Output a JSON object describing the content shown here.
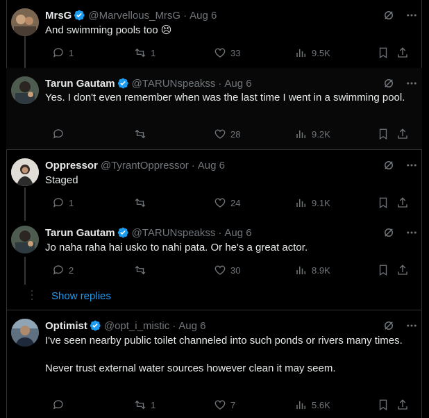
{
  "posts": [
    {
      "name": "MrsG",
      "handle": "@Marvellous_MrsG",
      "time": "Aug 6",
      "verified": true,
      "text": "And swimming pools too 😣",
      "replies": "1",
      "reposts": "1",
      "likes": "33",
      "views": "9.5K",
      "avatar_color": "#6b5a4a"
    },
    {
      "name": "Tarun Gautam",
      "handle": "@TARUNspeakss",
      "time": "Aug 6",
      "verified": true,
      "text": "Yes. I don't even remember when was the last time I went in a swimming pool.",
      "replies": "",
      "reposts": "",
      "likes": "28",
      "views": "9.2K",
      "avatar_color": "#3a4a44"
    },
    {
      "name": "Oppressor",
      "handle": "@TyrantOppressor",
      "time": "Aug 6",
      "verified": false,
      "text": "Staged",
      "replies": "1",
      "reposts": "",
      "likes": "24",
      "views": "9.1K",
      "avatar_color": "#d8d4cf"
    },
    {
      "name": "Tarun Gautam",
      "handle": "@TARUNspeakss",
      "time": "Aug 6",
      "verified": true,
      "text": "Jo naha raha hai usko to nahi pata. Or he's a great actor.",
      "replies": "2",
      "reposts": "",
      "likes": "30",
      "views": "8.9K",
      "avatar_color": "#3a4a44"
    },
    {
      "name": "Optimist",
      "handle": "@opt_i_mistic",
      "time": "Aug 6",
      "verified": true,
      "text": "I've seen nearby public toilet channeled into such ponds or rivers many times.\n\nNever trust external water sources however clean it may seem.",
      "replies": "",
      "reposts": "1",
      "likes": "7",
      "views": "5.6K",
      "avatar_color": "#4a5560"
    }
  ],
  "show_replies_label": "Show replies",
  "colors": {
    "background": "#000000",
    "text": "#e7e9ea",
    "muted": "#71767b",
    "accent": "#1d9bf0",
    "highlight_bg": "#080808"
  }
}
